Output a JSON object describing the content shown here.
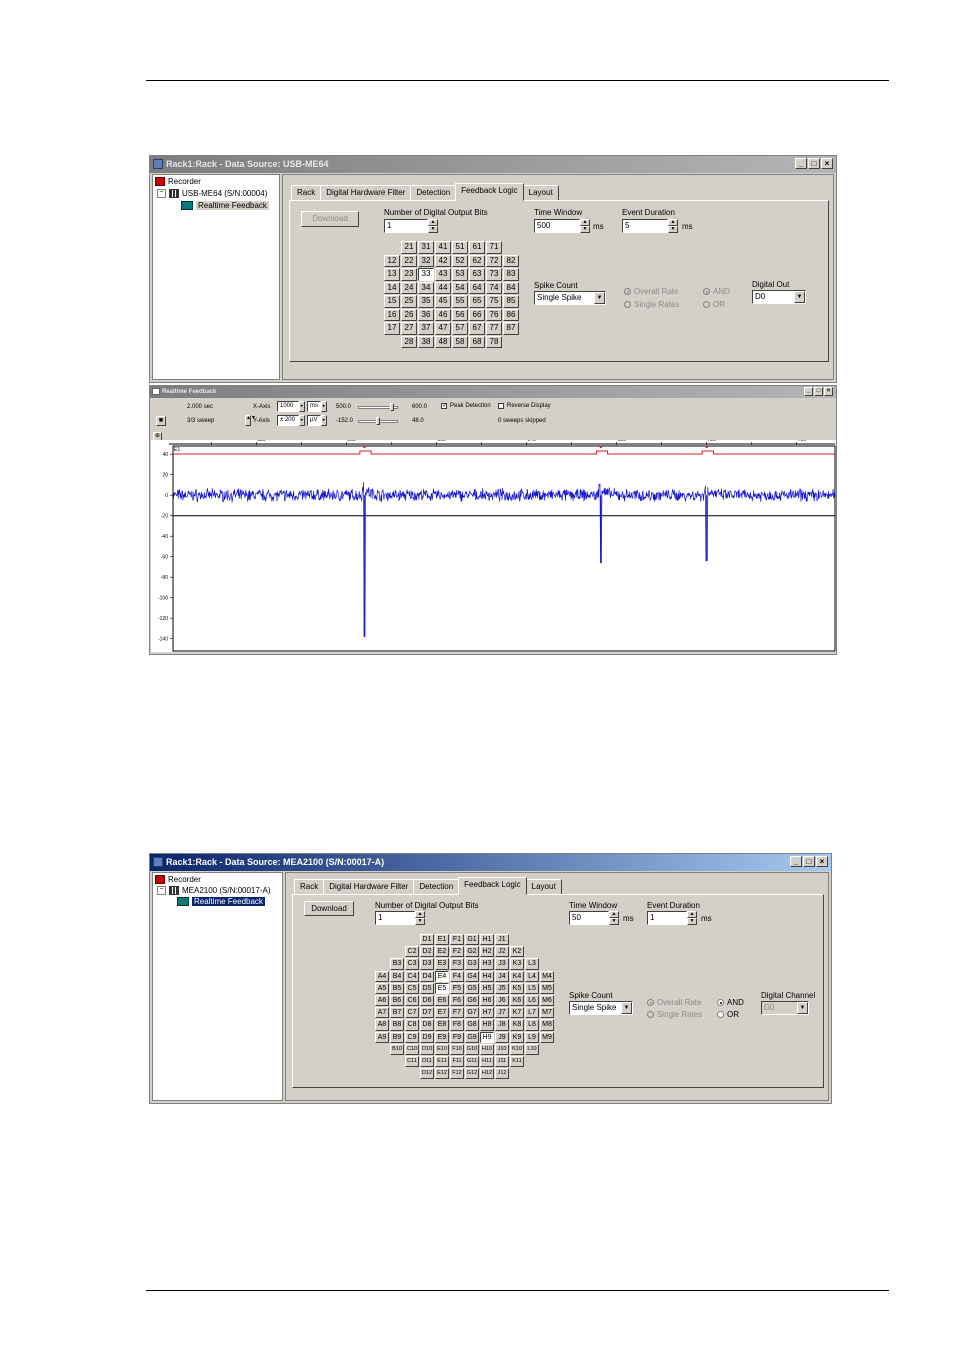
{
  "window1": {
    "title": "Rack1:Rack - Data Source: USB-ME64",
    "tree": {
      "root": "Recorder",
      "device": "USB-ME64   (S/N:00004)",
      "leaf": "Realtime Feedback"
    },
    "tabs": [
      "Rack",
      "Digital Hardware Filter",
      "Detection",
      "Feedback Logic",
      "Layout"
    ],
    "download_label": "Download",
    "bits_label": "Number of Digital Output Bits",
    "bits_value": "1",
    "time_window_label": "Time Window",
    "time_window_value": "500",
    "time_window_unit": "ms",
    "event_duration_label": "Event Duration",
    "event_duration_value": "5",
    "event_duration_unit": "ms",
    "spike_count_label": "Spike Count",
    "spike_count_value": "Single Spike",
    "rates": [
      "Overall Rate",
      "Single Rates"
    ],
    "logic": [
      "AND",
      "OR"
    ],
    "digital_out_label": "Digital Out",
    "digital_out_value": "D0",
    "electrodes": [
      [
        "",
        "21",
        "31",
        "41",
        "51",
        "61",
        "71",
        ""
      ],
      [
        "12",
        "22",
        "32",
        "42",
        "52",
        "62",
        "72",
        "82"
      ],
      [
        "13",
        "23",
        "33",
        "43",
        "53",
        "63",
        "73",
        "83"
      ],
      [
        "14",
        "24",
        "34",
        "44",
        "54",
        "64",
        "74",
        "84"
      ],
      [
        "15",
        "25",
        "35",
        "45",
        "55",
        "65",
        "75",
        "85"
      ],
      [
        "16",
        "26",
        "36",
        "46",
        "56",
        "66",
        "76",
        "86"
      ],
      [
        "17",
        "27",
        "37",
        "47",
        "57",
        "67",
        "77",
        "87"
      ],
      [
        "",
        "28",
        "38",
        "48",
        "58",
        "68",
        "78",
        ""
      ]
    ],
    "selected_electrode": "33"
  },
  "feedback": {
    "title": "Realtime Feedback",
    "time_label": "2.000 sec",
    "sweep_label": "3/3 sweep",
    "xaxis_label": "X-Axis",
    "xaxis_value": "1000",
    "xaxis_unit": "ms",
    "yaxis_label": "Y-Axis",
    "yaxis_value": "± 200",
    "yaxis_unit": "µV",
    "x_left": "500.0",
    "x_right": "600.0",
    "y_left": "-152.0",
    "y_right": "48.0",
    "peak_detection": "Peak Detection",
    "reverse_display": "Reverse Display",
    "skipped": "0 sweeps skipped",
    "channel": "E1"
  },
  "chart_data": {
    "type": "line",
    "x_ticks": [
      500,
      520,
      540,
      560,
      580,
      600,
      620,
      640,
      660,
      680,
      700,
      720,
      740,
      760
    ],
    "x_tick_labels": [
      "520",
      "560",
      "600",
      "640",
      "680",
      "720",
      "760"
    ],
    "y_ticks": [
      40,
      20,
      0,
      -20,
      -40,
      -60,
      -80,
      -100,
      -120,
      -140
    ],
    "y_tick_labels": [
      "40",
      "20",
      "0",
      "-20",
      "-40",
      "-60",
      "-80",
      "-100",
      "-120",
      "-140"
    ],
    "xlim": [
      483,
      777
    ],
    "ylim": [
      -152,
      48
    ],
    "threshold": -20,
    "spikes": [
      {
        "x": 568,
        "y": -138
      },
      {
        "x": 673,
        "y": -66
      },
      {
        "x": 720,
        "y": -64
      }
    ],
    "colors": {
      "signal": "#1515c8",
      "marker": "#d42020",
      "threshold": "#000000"
    }
  },
  "window2": {
    "title": "Rack1:Rack - Data Source: MEA2100 (S/N:00017-A)",
    "tree": {
      "root": "Recorder",
      "device": "MEA2100 (S/N:00017-A)",
      "leaf": "Realtime Feedback"
    },
    "tabs": [
      "Rack",
      "Digital Hardware Filter",
      "Detection",
      "Feedback Logic",
      "Layout"
    ],
    "download_label": "Download",
    "bits_label": "Number of Digital Output Bits",
    "bits_value": "1",
    "time_window_label": "Time Window",
    "time_window_value": "50",
    "time_window_unit": "ms",
    "event_duration_label": "Event Duration",
    "event_duration_value": "1",
    "event_duration_unit": "ms",
    "spike_count_label": "Spike Count",
    "spike_count_value": "Single Spike",
    "rates": [
      "Overall Rate",
      "Single Rates"
    ],
    "logic": [
      "AND",
      "OR"
    ],
    "digital_channel_label": "Digital Channel",
    "digital_channel_value": "D0",
    "rows": [
      [
        "D1",
        "E1",
        "F1",
        "G1",
        "H1",
        "J1"
      ],
      [
        "C2",
        "D2",
        "E2",
        "F2",
        "G2",
        "H2",
        "J2",
        "K2"
      ],
      [
        "B3",
        "C3",
        "D3",
        "E3",
        "F3",
        "G3",
        "H3",
        "J3",
        "K3",
        "L3"
      ],
      [
        "A4",
        "B4",
        "C4",
        "D4",
        "E4",
        "F4",
        "G4",
        "H4",
        "J4",
        "K4",
        "L4",
        "M4"
      ],
      [
        "A5",
        "B5",
        "C5",
        "D5",
        "E5",
        "F5",
        "G5",
        "H5",
        "J5",
        "K5",
        "L5",
        "M5"
      ],
      [
        "A6",
        "B6",
        "C6",
        "D6",
        "E6",
        "F6",
        "G6",
        "H6",
        "J6",
        "K6",
        "L6",
        "M6"
      ],
      [
        "A7",
        "B7",
        "C7",
        "D7",
        "E7",
        "F7",
        "G7",
        "H7",
        "J7",
        "K7",
        "L7",
        "M7"
      ],
      [
        "A8",
        "B8",
        "C8",
        "D8",
        "E8",
        "F8",
        "G8",
        "H8",
        "J8",
        "K8",
        "L8",
        "M8"
      ],
      [
        "A9",
        "B9",
        "C9",
        "D9",
        "E9",
        "F9",
        "G9",
        "H9",
        "J9",
        "K9",
        "L9",
        "M9"
      ],
      [
        "B10",
        "C10",
        "D10",
        "E10",
        "F10",
        "G10",
        "H10",
        "J10",
        "K10",
        "L10"
      ],
      [
        "C11",
        "D11",
        "E11",
        "F11",
        "G11",
        "H11",
        "J11",
        "K11"
      ],
      [
        "D12",
        "E12",
        "F12",
        "G12",
        "H12",
        "J12"
      ]
    ],
    "selected_cells": [
      "E4",
      "E5",
      "H9"
    ]
  }
}
